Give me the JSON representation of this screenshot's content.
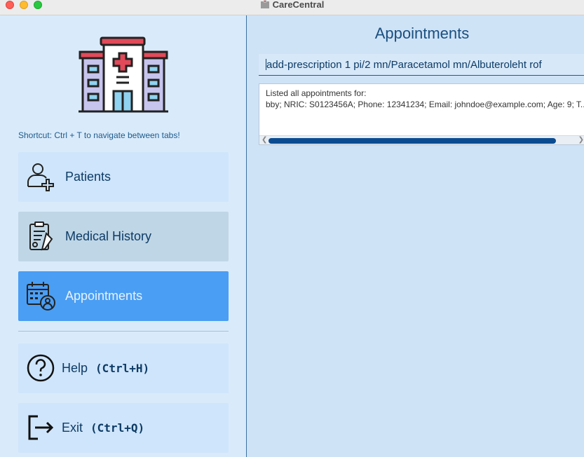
{
  "window": {
    "title": "CareCentral"
  },
  "sidebar": {
    "shortcut_hint": "Shortcut: Ctrl + T to navigate between tabs!",
    "items": [
      {
        "label": "Patients",
        "icon": "add-patient-icon"
      },
      {
        "label": "Medical History",
        "icon": "clipboard-icon"
      },
      {
        "label": "Appointments",
        "icon": "calendar-doctor-icon"
      }
    ],
    "help": {
      "label": "Help",
      "shortcut": "(Ctrl+H)"
    },
    "exit": {
      "label": "Exit",
      "shortcut": "(Ctrl+Q)"
    }
  },
  "main": {
    "title": "Appointments",
    "command_value": "add-prescription 1 pi/2 mn/Paracetamol mn/Albuteroleht rof",
    "result_line1": "Listed all appointments for:",
    "result_line2": "bby; NRIC: S0123456A; Phone: 12341234; Email: johndoe@example.com; Age: 9; T..."
  },
  "colors": {
    "sidebar_bg": "#d9ebfb",
    "selected_tab": "#4a9ef3",
    "main_bg": "#cfe3f7",
    "text_dark": "#0d3b66",
    "scroll_thumb": "#0b4c91"
  }
}
